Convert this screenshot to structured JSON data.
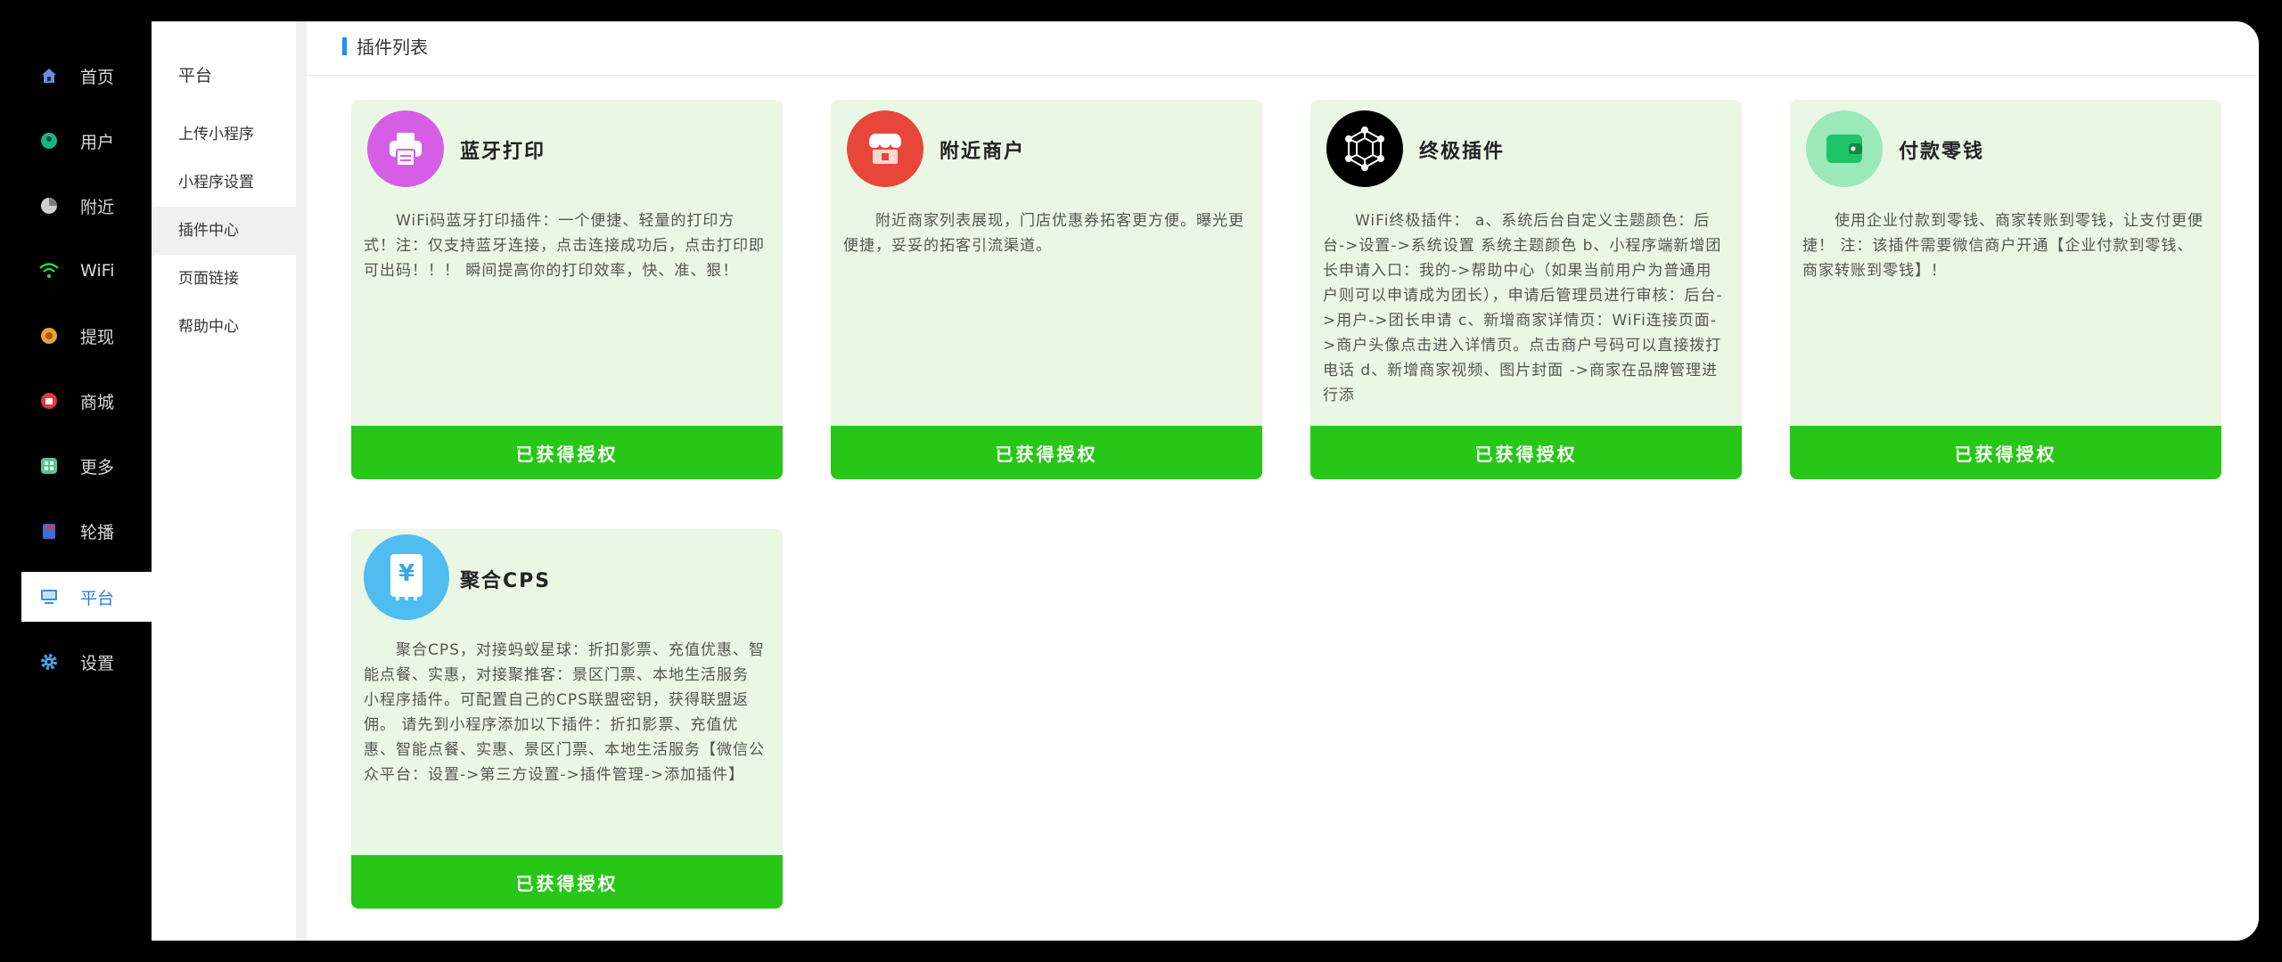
{
  "nav": {
    "items": [
      {
        "label": "首页",
        "icon": "home-icon"
      },
      {
        "label": "用户",
        "icon": "user-icon"
      },
      {
        "label": "附近",
        "icon": "nearby-icon"
      },
      {
        "label": "WiFi",
        "icon": "wifi-icon"
      },
      {
        "label": "提现",
        "icon": "withdraw-icon"
      },
      {
        "label": "商城",
        "icon": "shop-icon"
      },
      {
        "label": "更多",
        "icon": "more-icon"
      },
      {
        "label": "轮播",
        "icon": "carousel-icon"
      },
      {
        "label": "平台",
        "icon": "platform-icon"
      },
      {
        "label": "设置",
        "icon": "settings-gear-icon"
      }
    ],
    "active_index": 8
  },
  "subnav": {
    "title": "平台",
    "items": [
      {
        "label": "上传小程序"
      },
      {
        "label": "小程序设置"
      },
      {
        "label": "插件中心"
      },
      {
        "label": "页面链接"
      },
      {
        "label": "帮助中心"
      }
    ],
    "active_index": 2
  },
  "content": {
    "title": "插件列表"
  },
  "plugins": [
    {
      "name": "蓝牙打印",
      "icon": "printer-icon",
      "icon_color": "#d65ee6",
      "description": "WiFi码蓝牙打印插件：一个便捷、轻量的打印方式！注：仅支持蓝牙连接，点击连接成功后，点击打印即可出码！！！ 瞬间提高你的打印效率，快、准、狠！",
      "button": "已获得授权"
    },
    {
      "name": "附近商户",
      "icon": "store-icon",
      "icon_color": "#e8463a",
      "description": "附近商家列表展现，门店优惠券拓客更方便。曝光更便捷，妥妥的拓客引流渠道。",
      "button": "已获得授权"
    },
    {
      "name": "终极插件",
      "icon": "network-icon",
      "icon_color": "#000000",
      "description": "WiFi终极插件： a、系统后台自定义主题颜色：后台->设置->系统设置 系统主题颜色 b、小程序端新增团长申请入口：我的->帮助中心（如果当前用户为普通用户则可以申请成为团长），申请后管理员进行审核：后台->用户->团长申请 c、新增商家详情页：WiFi连接页面->商户头像点击进入详情页。点击商户号码可以直接拨打电话 d、新增商家视频、图片封面 ->商家在品牌管理进行添",
      "button": "已获得授权"
    },
    {
      "name": "付款零钱",
      "icon": "wallet-icon",
      "icon_color": "#9be8b8",
      "description": "使用企业付款到零钱、商家转账到零钱，让支付更便捷！ 注：该插件需要微信商户开通【企业付款到零钱、商家转账到零钱】！",
      "button": "已获得授权"
    },
    {
      "name": "聚合CPS",
      "icon": "yuan-coupon-icon",
      "icon_color": "#4fbdf0",
      "description": "聚合CPS，对接蚂蚁星球：折扣影票、充值优惠、智能点餐、实惠，对接聚推客：景区门票、本地生活服务 小程序插件。可配置自己的CPS联盟密钥，获得联盟返佣。 请先到小程序添加以下插件：折扣影票、充值优惠、智能点餐、实惠、景区门票、本地生活服务【微信公众平台：设置->第三方设置->插件管理->添加插件】",
      "button": "已获得授权"
    }
  ]
}
